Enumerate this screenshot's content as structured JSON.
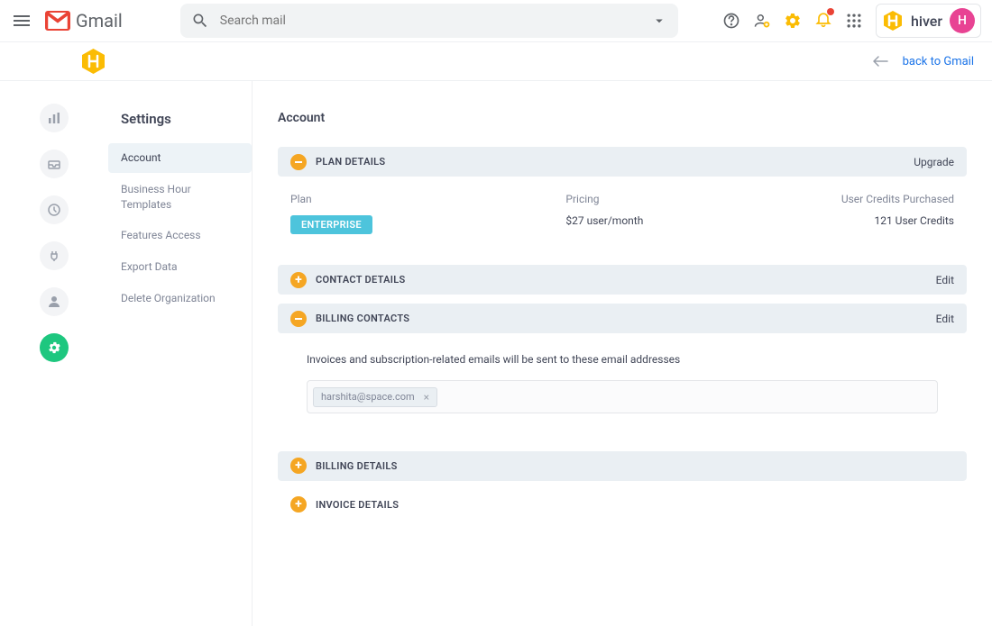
{
  "header": {
    "gmail_text": "Gmail",
    "search_placeholder": "Search mail"
  },
  "sub_header": {
    "back_label": "back to Gmail"
  },
  "hiver": {
    "brand_text": "hiver",
    "avatar_initial": "H"
  },
  "sidebar": {
    "title": "Settings",
    "items": [
      {
        "label": "Account",
        "active": true
      },
      {
        "label": "Business Hour Templates",
        "active": false
      },
      {
        "label": "Features Access",
        "active": false
      },
      {
        "label": "Export Data",
        "active": false
      },
      {
        "label": "Delete Organization",
        "active": false
      }
    ]
  },
  "page": {
    "title": "Account"
  },
  "sections": {
    "plan_details": {
      "title": "PLAN DETAILS",
      "action": "Upgrade",
      "plan_label": "Plan",
      "plan_value": "ENTERPRISE",
      "pricing_label": "Pricing",
      "pricing_value": "$27 user/month",
      "credits_label": "User Credits Purchased",
      "credits_value": "121 User Credits"
    },
    "contact_details": {
      "title": "CONTACT DETAILS",
      "action": "Edit"
    },
    "billing_contacts": {
      "title": "BILLING CONTACTS",
      "action": "Edit",
      "description": "Invoices and subscription-related emails will be sent to these email addresses",
      "emails": [
        "harshita@space.com"
      ]
    },
    "billing_details": {
      "title": "BILLING DETAILS"
    },
    "invoice_details": {
      "title": "INVOICE DETAILS"
    }
  }
}
